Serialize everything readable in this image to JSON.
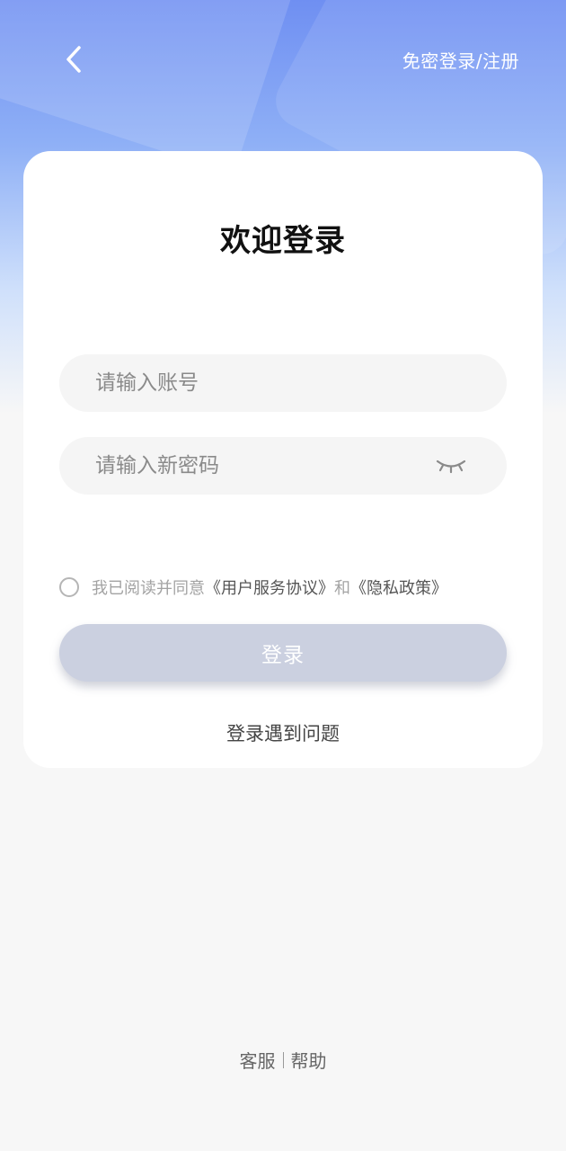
{
  "header": {
    "register_link": "免密登录/注册"
  },
  "card": {
    "title": "欢迎登录",
    "account_placeholder": "请输入账号",
    "password_placeholder": "请输入新密码",
    "agreement": {
      "prefix": "我已阅读并同意",
      "user_agreement": "《用户服务协议》",
      "conjunction": "和",
      "privacy_policy": "《隐私政策》"
    },
    "login_button": "登录",
    "trouble_link": "登录遇到问题"
  },
  "footer": {
    "service": "客服",
    "help": "帮助"
  },
  "icons": {
    "back": "chevron-left-icon",
    "password_toggle": "eye-closed-icon"
  },
  "colors": {
    "header_gradient_top": "#6f8ff2",
    "login_button_disabled": "#cbd0e0",
    "page_background": "#f7f7f7"
  }
}
